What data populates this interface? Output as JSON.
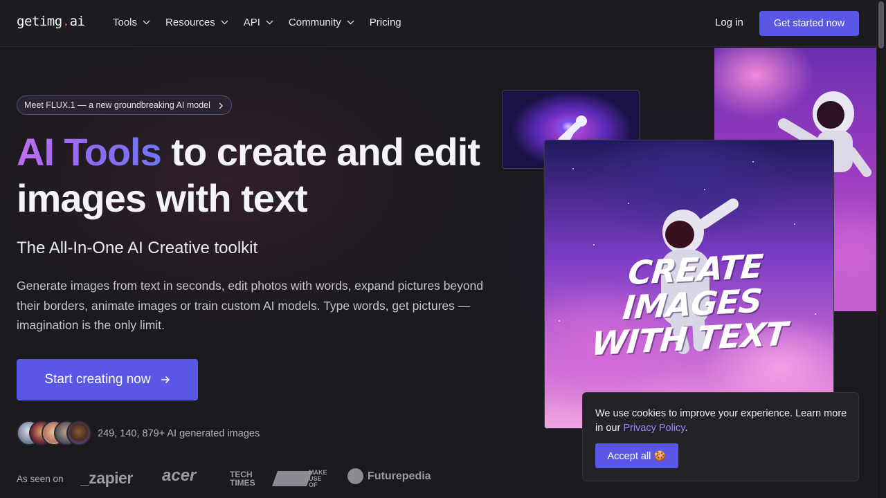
{
  "brand": {
    "logo_pre": "getimg",
    "logo_dot": ".",
    "logo_post": "ai"
  },
  "nav": {
    "items": [
      {
        "label": "Tools",
        "dropdown": true
      },
      {
        "label": "Resources",
        "dropdown": true
      },
      {
        "label": "API",
        "dropdown": true
      },
      {
        "label": "Community",
        "dropdown": true
      },
      {
        "label": "Pricing",
        "dropdown": false
      }
    ],
    "login": "Log in",
    "cta": "Get started now"
  },
  "hero": {
    "pill": "Meet FLUX.1 — a new groundbreaking AI model",
    "headline_highlight": "AI Tools",
    "headline_rest_1": " to create and edit",
    "headline_rest_2": "images with text",
    "subhead": "The All-In-One AI Creative toolkit",
    "description": "Generate images from text in seconds, edit photos with words, expand pictures beyond their borders, animate images or train custom AI models. Type words, get pictures — imagination is the only limit.",
    "cta": "Start creating now",
    "images_count": "249, 140, 879+ AI generated images",
    "image_overlay_line1": "CREATE IMAGES",
    "image_overlay_line2": "WITH TEXT"
  },
  "seen_on": {
    "label": "As seen on",
    "brands": [
      "zapier",
      "acer",
      "TECH TIMES",
      "MAKE USE OF",
      "Futurepedia"
    ]
  },
  "cookie": {
    "text_before": "We use cookies to improve your experience. Learn more in our ",
    "link": "Privacy Policy",
    "text_after": ".",
    "button": "Accept all 🍪"
  },
  "colors": {
    "accent": "#5b57e6",
    "background": "#1b1a1f",
    "logo_dot": "#f0446b"
  }
}
